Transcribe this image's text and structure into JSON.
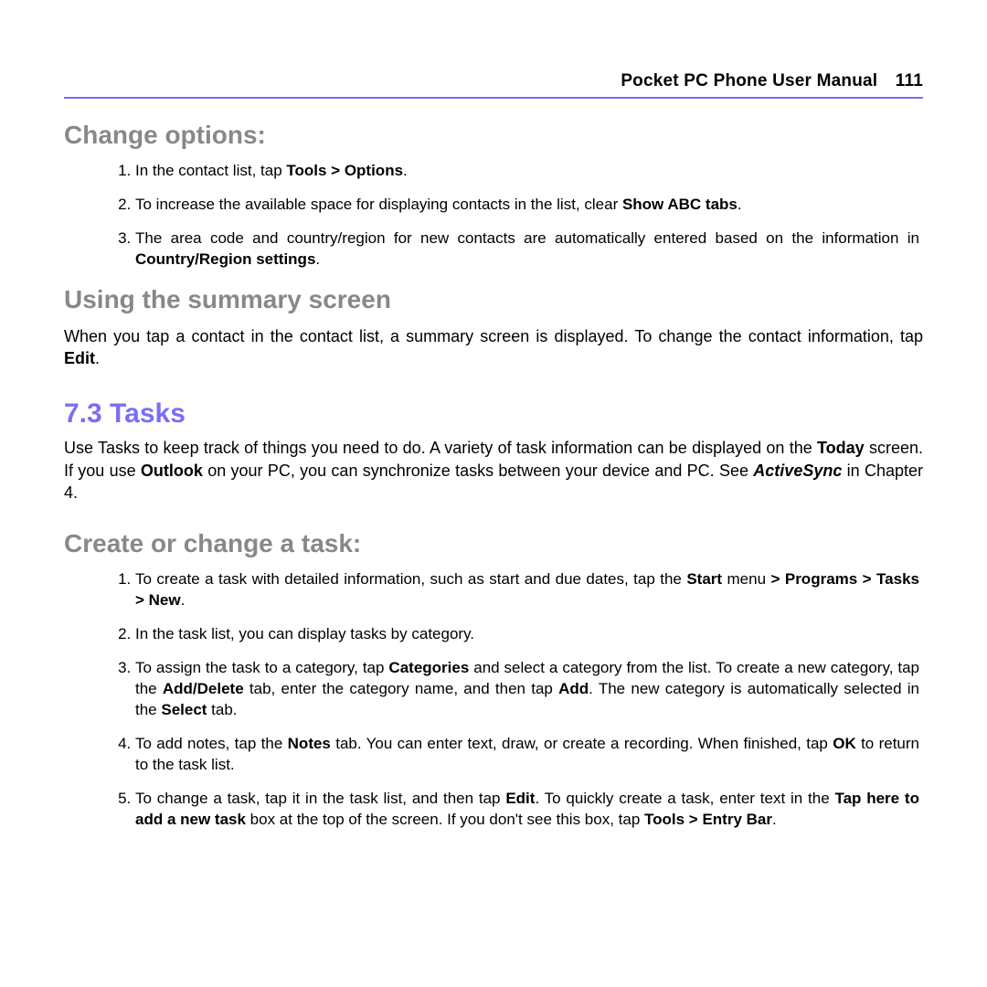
{
  "header": {
    "title": "Pocket PC Phone User Manual",
    "page": "111"
  },
  "s1": {
    "heading": "Change options:",
    "li1_a": "In the contact list, tap ",
    "li1_b": "Tools > Options",
    "li1_c": ".",
    "li2_a": "To increase the available space for displaying contacts in the list, clear ",
    "li2_b": "Show ABC tabs",
    "li2_c": ".",
    "li3_a": "The area code and country/region for new contacts are automatically entered based on the information in ",
    "li3_b": "Country/Region settings",
    "li3_c": "."
  },
  "s2": {
    "heading": "Using the summary screen",
    "p_a": "When you tap a contact in the contact list, a summary screen is displayed. To change the contact information, tap ",
    "p_b": "Edit",
    "p_c": "."
  },
  "s3": {
    "heading": "7.3 Tasks",
    "p_a": "Use Tasks to keep track of things you need to do. A variety of task information can be displayed on the ",
    "p_b": "Today",
    "p_c": " screen. If you use ",
    "p_d": "Outlook",
    "p_e": " on your PC, you can synchronize tasks between your device and PC. See ",
    "p_f": "ActiveSync",
    "p_g": " in Chapter 4."
  },
  "s4": {
    "heading": "Create or change a task:",
    "li1_a": "To create a task with detailed information, such as start and due dates, tap the ",
    "li1_b": "Start",
    "li1_c": " menu ",
    "li1_d": "> Programs  > Tasks > New",
    "li1_e": ".",
    "li2": "In the task list, you can display tasks by category.",
    "li3_a": "To assign the task to a category, tap ",
    "li3_b": "Categories",
    "li3_c": " and select a category from the list. To create a new category, tap the ",
    "li3_d": "Add/Delete",
    "li3_e": " tab, enter the category name, and then tap ",
    "li3_f": "Add",
    "li3_g": ". The new category is automatically selected in the ",
    "li3_h": "Select",
    "li3_i": " tab.",
    "li4_a": "To add notes, tap the ",
    "li4_b": "Notes",
    "li4_c": " tab. You can enter text, draw, or create a recording. When finished, tap ",
    "li4_d": "OK",
    "li4_e": " to return to the task list.",
    "li5_a": "To change a task, tap it in the task list, and then tap ",
    "li5_b": "Edit",
    "li5_c": ". To quickly create a task, enter text in the ",
    "li5_d": "Tap here to add a new task",
    "li5_e": " box at the top of the screen. If you don't see this box, tap ",
    "li5_f": "Tools > Entry Bar",
    "li5_g": "."
  }
}
